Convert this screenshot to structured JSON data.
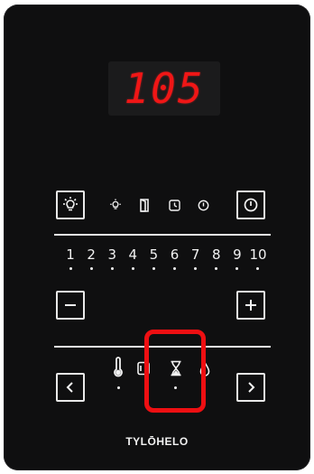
{
  "display": {
    "value": "105",
    "color": "#f01616"
  },
  "buttons": {
    "light": {
      "icon": "light-bulb-icon"
    },
    "power": {
      "icon": "power-icon"
    },
    "minus": {
      "icon": "minus-icon"
    },
    "plus": {
      "icon": "plus-icon"
    },
    "prev": {
      "icon": "chevron-left-icon"
    },
    "next": {
      "icon": "chevron-right-icon"
    }
  },
  "status_icons": [
    "light-bulb-icon",
    "door-icon",
    "clock-icon",
    "power-icon"
  ],
  "levels": [
    "1",
    "2",
    "3",
    "4",
    "5",
    "6",
    "7",
    "8",
    "9",
    "10"
  ],
  "modes": [
    "thermometer-icon",
    "humidity-frame-icon",
    "hourglass-icon",
    "drop-icon"
  ],
  "selected_mode": "hourglass-icon",
  "highlight_color": "#ee0f12",
  "brand": {
    "name": "TYLŌHELO"
  }
}
